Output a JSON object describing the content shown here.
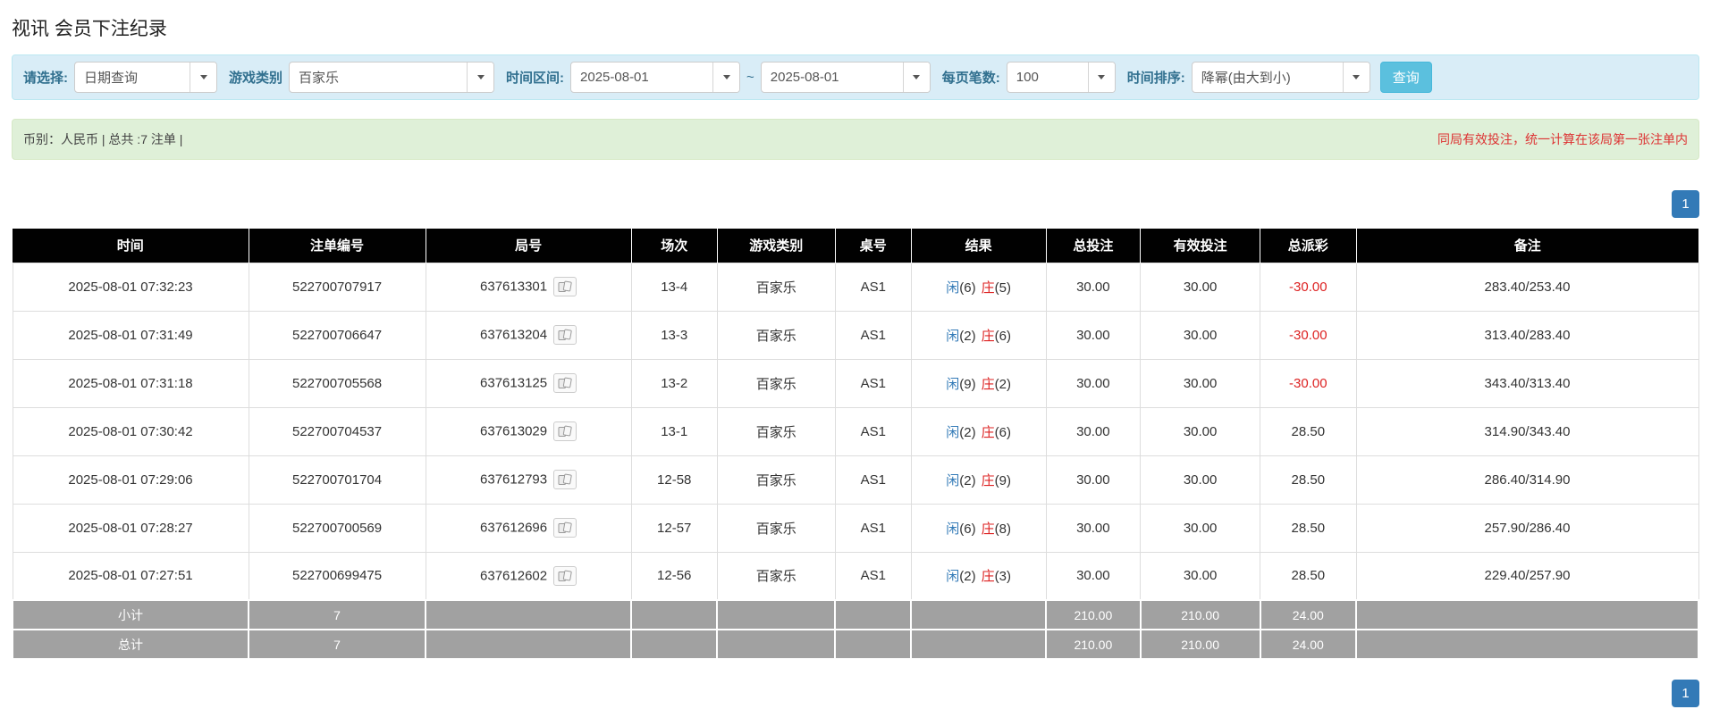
{
  "page": {
    "title": "视讯 会员下注纪录"
  },
  "filters": {
    "select_label": "请选择:",
    "select_value": "日期查询",
    "game_type_label": "游戏类别",
    "game_type_value": "百家乐",
    "time_range_label": "时间区间:",
    "date_from": "2025-08-01",
    "range_separator": "~",
    "date_to": "2025-08-01",
    "page_size_label": "每页笔数:",
    "page_size_value": "100",
    "sort_label": "时间排序:",
    "sort_value": "降幂(由大到小)",
    "search_button": "查询"
  },
  "summary": {
    "info": "币别：人民币 | 总共 :7 注单 |",
    "note": "同局有效投注，统一计算在该局第一张注单内"
  },
  "pagination": {
    "page": "1"
  },
  "table": {
    "headers": [
      "时间",
      "注单编号",
      "局号",
      "场次",
      "游戏类别",
      "桌号",
      "结果",
      "总投注",
      "有效投注",
      "总派彩",
      "备注"
    ],
    "rows": [
      {
        "time": "2025-08-01 07:32:23",
        "bet_id": "522700707917",
        "round_id": "637613301",
        "session": "13-4",
        "game": "百家乐",
        "table_no": "AS1",
        "player_label": "闲",
        "player_points": "(6)",
        "banker_label": "庄",
        "banker_points": "(5)",
        "total_bet": "30.00",
        "valid_bet": "30.00",
        "payout": "-30.00",
        "remark": "283.40/253.40"
      },
      {
        "time": "2025-08-01 07:31:49",
        "bet_id": "522700706647",
        "round_id": "637613204",
        "session": "13-3",
        "game": "百家乐",
        "table_no": "AS1",
        "player_label": "闲",
        "player_points": "(2)",
        "banker_label": "庄",
        "banker_points": "(6)",
        "total_bet": "30.00",
        "valid_bet": "30.00",
        "payout": "-30.00",
        "remark": "313.40/283.40"
      },
      {
        "time": "2025-08-01 07:31:18",
        "bet_id": "522700705568",
        "round_id": "637613125",
        "session": "13-2",
        "game": "百家乐",
        "table_no": "AS1",
        "player_label": "闲",
        "player_points": "(9)",
        "banker_label": "庄",
        "banker_points": "(2)",
        "total_bet": "30.00",
        "valid_bet": "30.00",
        "payout": "-30.00",
        "remark": "343.40/313.40"
      },
      {
        "time": "2025-08-01 07:30:42",
        "bet_id": "522700704537",
        "round_id": "637613029",
        "session": "13-1",
        "game": "百家乐",
        "table_no": "AS1",
        "player_label": "闲",
        "player_points": "(2)",
        "banker_label": "庄",
        "banker_points": "(6)",
        "total_bet": "30.00",
        "valid_bet": "30.00",
        "payout": "28.50",
        "remark": "314.90/343.40"
      },
      {
        "time": "2025-08-01 07:29:06",
        "bet_id": "522700701704",
        "round_id": "637612793",
        "session": "12-58",
        "game": "百家乐",
        "table_no": "AS1",
        "player_label": "闲",
        "player_points": "(2)",
        "banker_label": "庄",
        "banker_points": "(9)",
        "total_bet": "30.00",
        "valid_bet": "30.00",
        "payout": "28.50",
        "remark": "286.40/314.90"
      },
      {
        "time": "2025-08-01 07:28:27",
        "bet_id": "522700700569",
        "round_id": "637612696",
        "session": "12-57",
        "game": "百家乐",
        "table_no": "AS1",
        "player_label": "闲",
        "player_points": "(6)",
        "banker_label": "庄",
        "banker_points": "(8)",
        "total_bet": "30.00",
        "valid_bet": "30.00",
        "payout": "28.50",
        "remark": "257.90/286.40"
      },
      {
        "time": "2025-08-01 07:27:51",
        "bet_id": "522700699475",
        "round_id": "637612602",
        "session": "12-56",
        "game": "百家乐",
        "table_no": "AS1",
        "player_label": "闲",
        "player_points": "(2)",
        "banker_label": "庄",
        "banker_points": "(3)",
        "total_bet": "30.00",
        "valid_bet": "30.00",
        "payout": "28.50",
        "remark": "229.40/257.90"
      }
    ],
    "subtotal": {
      "label": "小计",
      "count": "7",
      "total_bet": "210.00",
      "valid_bet": "210.00",
      "payout": "24.00"
    },
    "total": {
      "label": "总计",
      "count": "7",
      "total_bet": "210.00",
      "valid_bet": "210.00",
      "payout": "24.00"
    }
  },
  "colors": {
    "accent_blue": "#337ab7",
    "player_blue": "#337ab7",
    "banker_red": "#dd2222",
    "negative_red": "#dd2222",
    "note_red": "#dd3333",
    "filter_bar_bg": "#d9edf7",
    "summary_bar_bg": "#dff0d8",
    "table_header_bg": "#010101",
    "table_footer_bg": "#a1a1a1",
    "search_button_bg": "#5bc0de"
  }
}
